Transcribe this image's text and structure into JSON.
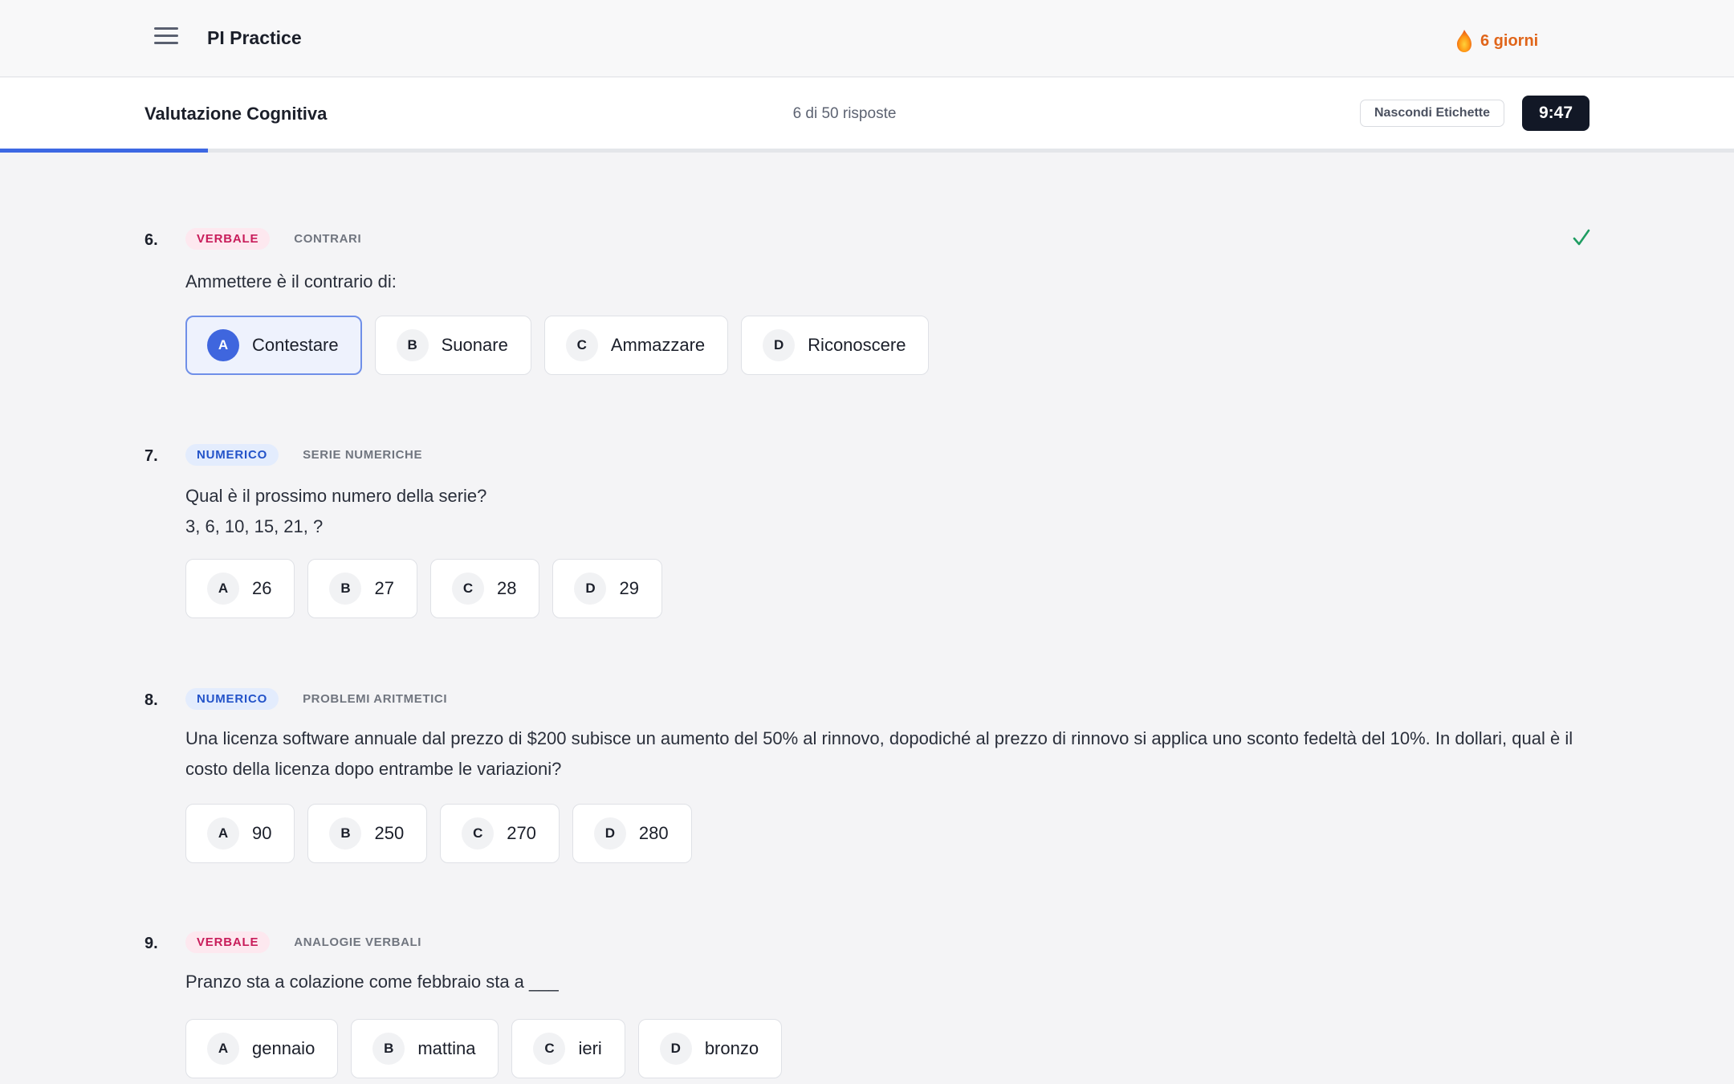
{
  "app": {
    "title": "PI Practice",
    "streak_label": "6 giorni"
  },
  "test": {
    "title": "Valutazione Cognitiva",
    "progress_text": "6 di 50 risposte",
    "progress_fraction": 0.12,
    "hide_labels_button": "Nascondi Etichette",
    "timer": "9:47"
  },
  "questions": [
    {
      "number": "6.",
      "category": "VERBALE",
      "subcategory": "CONTRARI",
      "answered": true,
      "text_lines": [
        "Ammettere è il contrario di:"
      ],
      "selected": "A",
      "options": [
        {
          "letter": "A",
          "label": "Contestare"
        },
        {
          "letter": "B",
          "label": "Suonare"
        },
        {
          "letter": "C",
          "label": "Ammazzare"
        },
        {
          "letter": "D",
          "label": "Riconoscere"
        }
      ]
    },
    {
      "number": "7.",
      "category": "NUMERICO",
      "subcategory": "SERIE NUMERICHE",
      "answered": false,
      "text_lines": [
        "Qual è il prossimo numero della serie?",
        "3, 6, 10, 15, 21, ?"
      ],
      "selected": null,
      "options": [
        {
          "letter": "A",
          "label": "26"
        },
        {
          "letter": "B",
          "label": "27"
        },
        {
          "letter": "C",
          "label": "28"
        },
        {
          "letter": "D",
          "label": "29"
        }
      ]
    },
    {
      "number": "8.",
      "category": "NUMERICO",
      "subcategory": "PROBLEMI ARITMETICI",
      "answered": false,
      "text_lines": [
        "Una licenza software annuale dal prezzo di $200 subisce un aumento del 50% al rinnovo, dopodiché al prezzo di rinnovo si applica uno sconto fedeltà del 10%. In dollari, qual è il costo della licenza dopo entrambe le variazioni?"
      ],
      "selected": null,
      "options": [
        {
          "letter": "A",
          "label": "90"
        },
        {
          "letter": "B",
          "label": "250"
        },
        {
          "letter": "C",
          "label": "270"
        },
        {
          "letter": "D",
          "label": "280"
        }
      ]
    },
    {
      "number": "9.",
      "category": "VERBALE",
      "subcategory": "ANALOGIE VERBALI",
      "answered": false,
      "text_lines": [
        "Pranzo sta a colazione come febbraio sta a ___"
      ],
      "selected": null,
      "options": [
        {
          "letter": "A",
          "label": "gennaio"
        },
        {
          "letter": "B",
          "label": "mattina"
        },
        {
          "letter": "C",
          "label": "ieri"
        },
        {
          "letter": "D",
          "label": "bronzo"
        }
      ]
    }
  ],
  "colors": {
    "accent": "#3d68e3",
    "verbal_tag": "#c81c5a",
    "numeric_tag": "#2353c9",
    "streak": "#e0651a",
    "check": "#1f9d62"
  },
  "icons": {
    "menu": "hamburger-menu-icon",
    "streak": "flame-icon",
    "answered": "checkmark-icon"
  }
}
